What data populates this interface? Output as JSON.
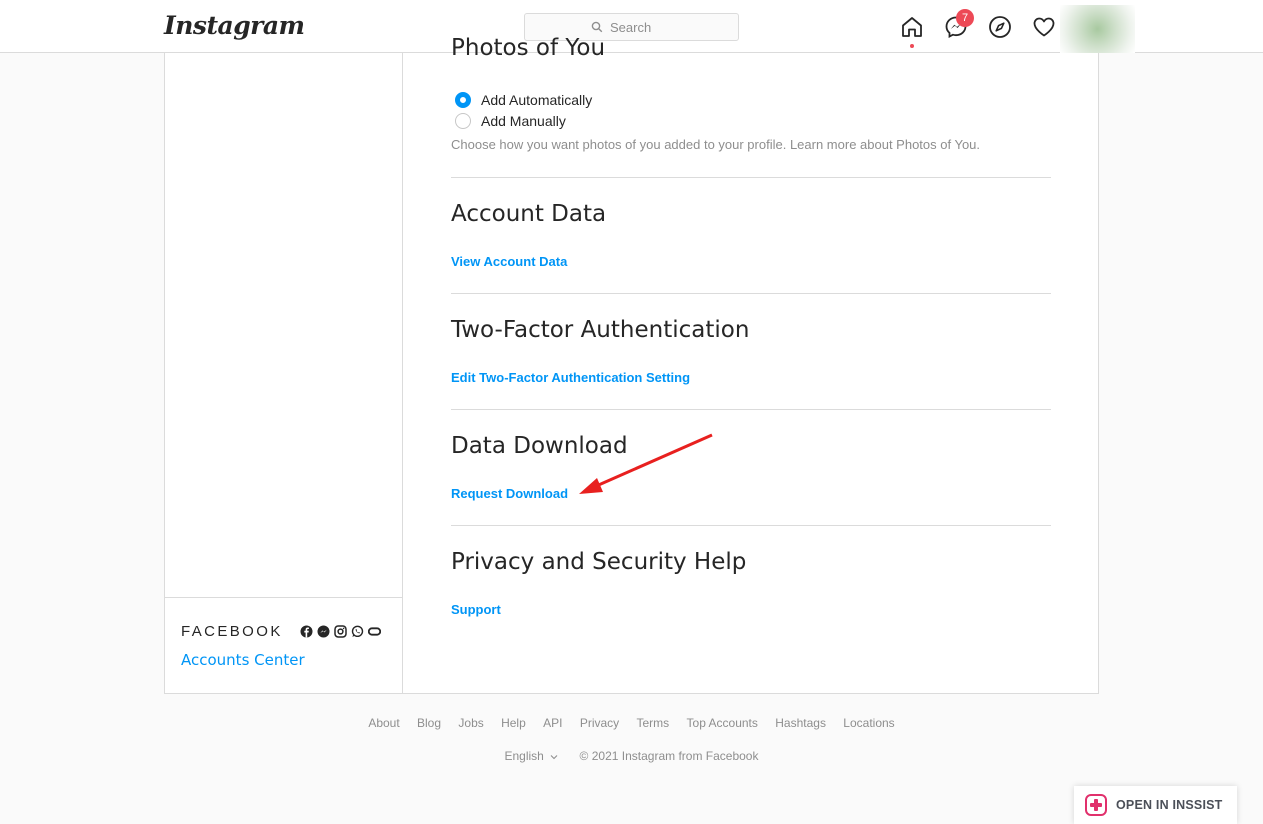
{
  "header": {
    "logo": "Instagram",
    "search_placeholder": "Search",
    "messages_badge": "7"
  },
  "sidebar": {
    "facebook_label": "FACEBOOK",
    "accounts_center": "Accounts Center"
  },
  "sections": {
    "photos_of_you": {
      "title": "Photos of You",
      "options": [
        "Add Automatically",
        "Add Manually"
      ],
      "selected": "Add Automatically",
      "hint": "Choose how you want photos of you added to your profile. Learn more about Photos of You."
    },
    "account_data": {
      "title": "Account Data",
      "link": "View Account Data"
    },
    "two_factor": {
      "title": "Two-Factor Authentication",
      "link": "Edit Two-Factor Authentication Setting"
    },
    "data_download": {
      "title": "Data Download",
      "link": "Request Download"
    },
    "help": {
      "title": "Privacy and Security Help",
      "link": "Support"
    }
  },
  "footer": {
    "links": [
      "About",
      "Blog",
      "Jobs",
      "Help",
      "API",
      "Privacy",
      "Terms",
      "Top Accounts",
      "Hashtags",
      "Locations"
    ],
    "language": "English",
    "copyright": "© 2021 Instagram from Facebook"
  },
  "extension": {
    "label": "OPEN IN INSSIST"
  },
  "colors": {
    "link": "#0095f6",
    "badge": "#ed4956",
    "annotation_arrow": "#e8201f"
  }
}
